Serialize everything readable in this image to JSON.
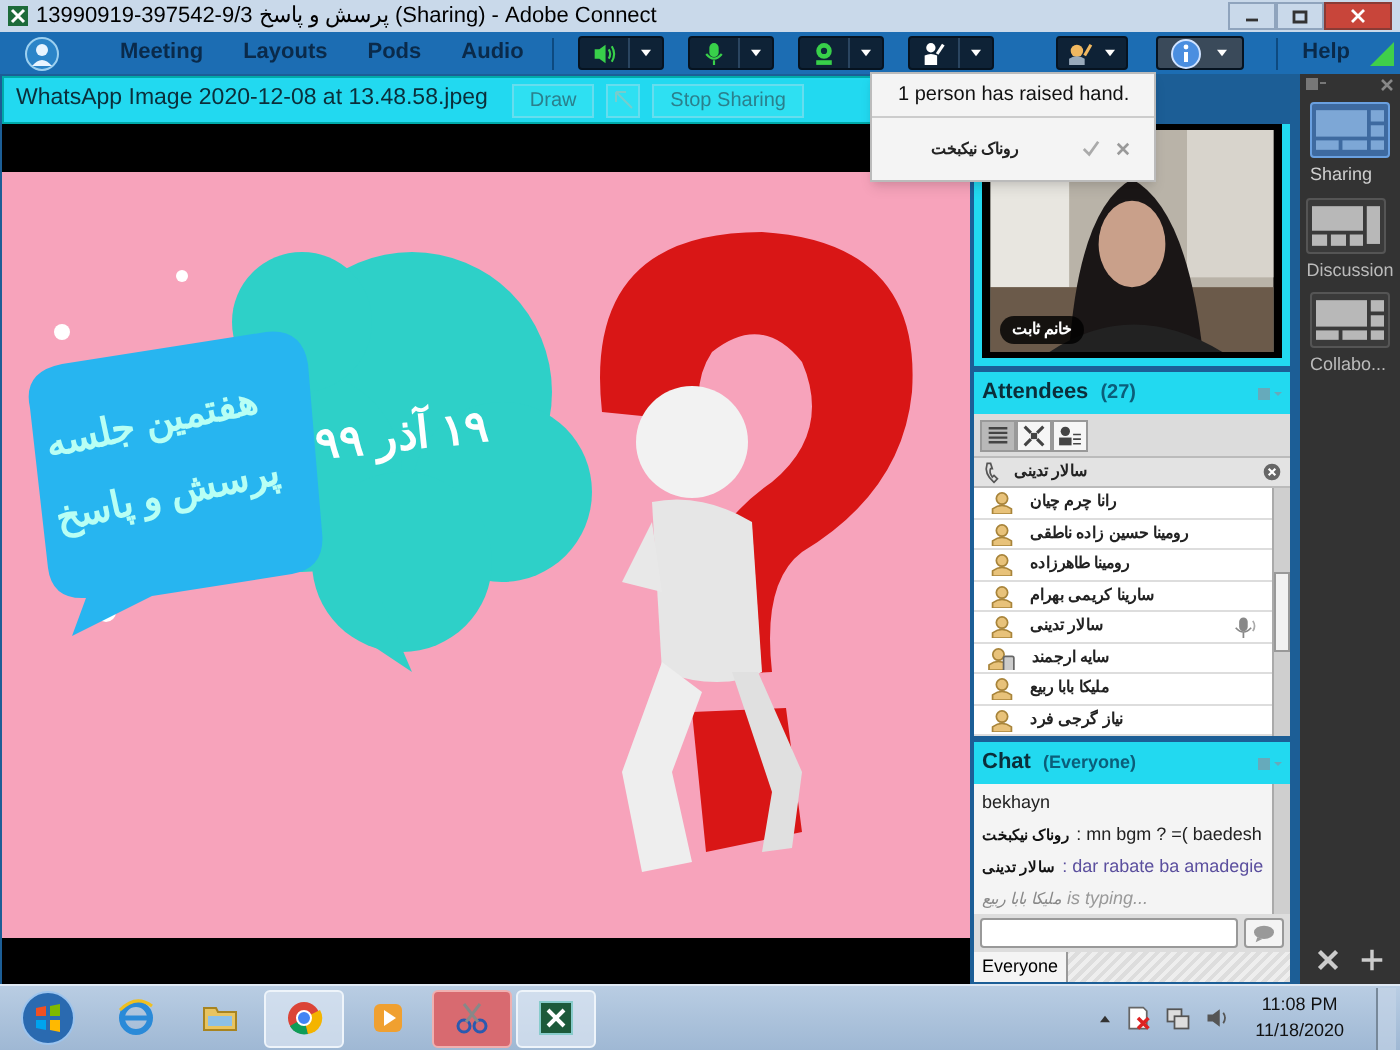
{
  "window": {
    "title": "13990919-397542-9/3 پرسش و پاسخ (Sharing) - Adobe Connect"
  },
  "menu": {
    "meeting": "Meeting",
    "layouts": "Layouts",
    "pods": "Pods",
    "audio": "Audio"
  },
  "toolbar": [
    {
      "kind": "speaker"
    },
    {
      "kind": "mic"
    },
    {
      "kind": "camera"
    },
    {
      "kind": "hand"
    }
  ],
  "help": "Help",
  "share_pod": {
    "title": "WhatsApp Image 2020-12-08 at 13.48.58.jpeg",
    "draw_button": "Draw",
    "stop_sharing_button": "Stop Sharing"
  },
  "slide": {
    "date": "۱۹ آذر ۹۹",
    "lines": [
      "هفتمین جلسه",
      "پرسش و پاسخ"
    ]
  },
  "notification": {
    "message": "1 person has raised hand.",
    "name": "روناک نیکبخت"
  },
  "video": {
    "label": "خانم ثابت"
  },
  "attendees": {
    "title": "Attendees",
    "count": "(27)",
    "views": [
      {
        "kind": "list",
        "selected": true
      },
      {
        "kind": "grid",
        "selected": false
      },
      {
        "kind": "roles",
        "selected": false
      }
    ],
    "speaker": "سالار تدینی",
    "items": [
      {
        "name": "رانا چرم چیان",
        "kind": "user",
        "speaking": false
      },
      {
        "name": "رومینا حسین زاده ناطقی",
        "kind": "user",
        "speaking": false
      },
      {
        "name": "رومینا طاهرزاده",
        "kind": "user",
        "speaking": false
      },
      {
        "name": "سارینا کریمی بهرام",
        "kind": "user",
        "speaking": false
      },
      {
        "name": "سالار تدینی",
        "kind": "user",
        "speaking": true
      },
      {
        "name": "سایه ارجمند",
        "kind": "mobile",
        "speaking": false
      },
      {
        "name": "ملیکا بابا ربیع",
        "kind": "user",
        "speaking": false
      },
      {
        "name": "نیاز گرجی فرد",
        "kind": "user",
        "speaking": false
      }
    ]
  },
  "chat": {
    "title": "Chat",
    "scope": "(Everyone)",
    "messages": [
      {
        "text": "bekhayn",
        "color": "#222222"
      },
      {
        "sender": "روناک نیکبخت",
        "text": ": mn bgm ? =( baedesh",
        "color": "#222222"
      },
      {
        "sender": "سالار تدینی",
        "text": ": dar rabate ba amadegie",
        "color": "#5b4f9e"
      }
    ],
    "typing_name": "ملیکا بابا ربیع",
    "typing_text": "is typing...",
    "tab": "Everyone"
  },
  "layouts": [
    {
      "label": "Sharing",
      "selected": true
    },
    {
      "label": "Discussion",
      "selected": false
    },
    {
      "label": "Collabo...",
      "selected": false
    }
  ],
  "taskbar": {
    "apps": [
      {
        "kind": "ie",
        "active": false
      },
      {
        "kind": "folder",
        "active": false
      },
      {
        "kind": "chrome",
        "active": true
      },
      {
        "kind": "media",
        "active": false
      },
      {
        "kind": "snip",
        "active": true
      },
      {
        "kind": "connect",
        "active": true
      }
    ],
    "time": "11:08 PM",
    "date": "11/18/2020"
  }
}
